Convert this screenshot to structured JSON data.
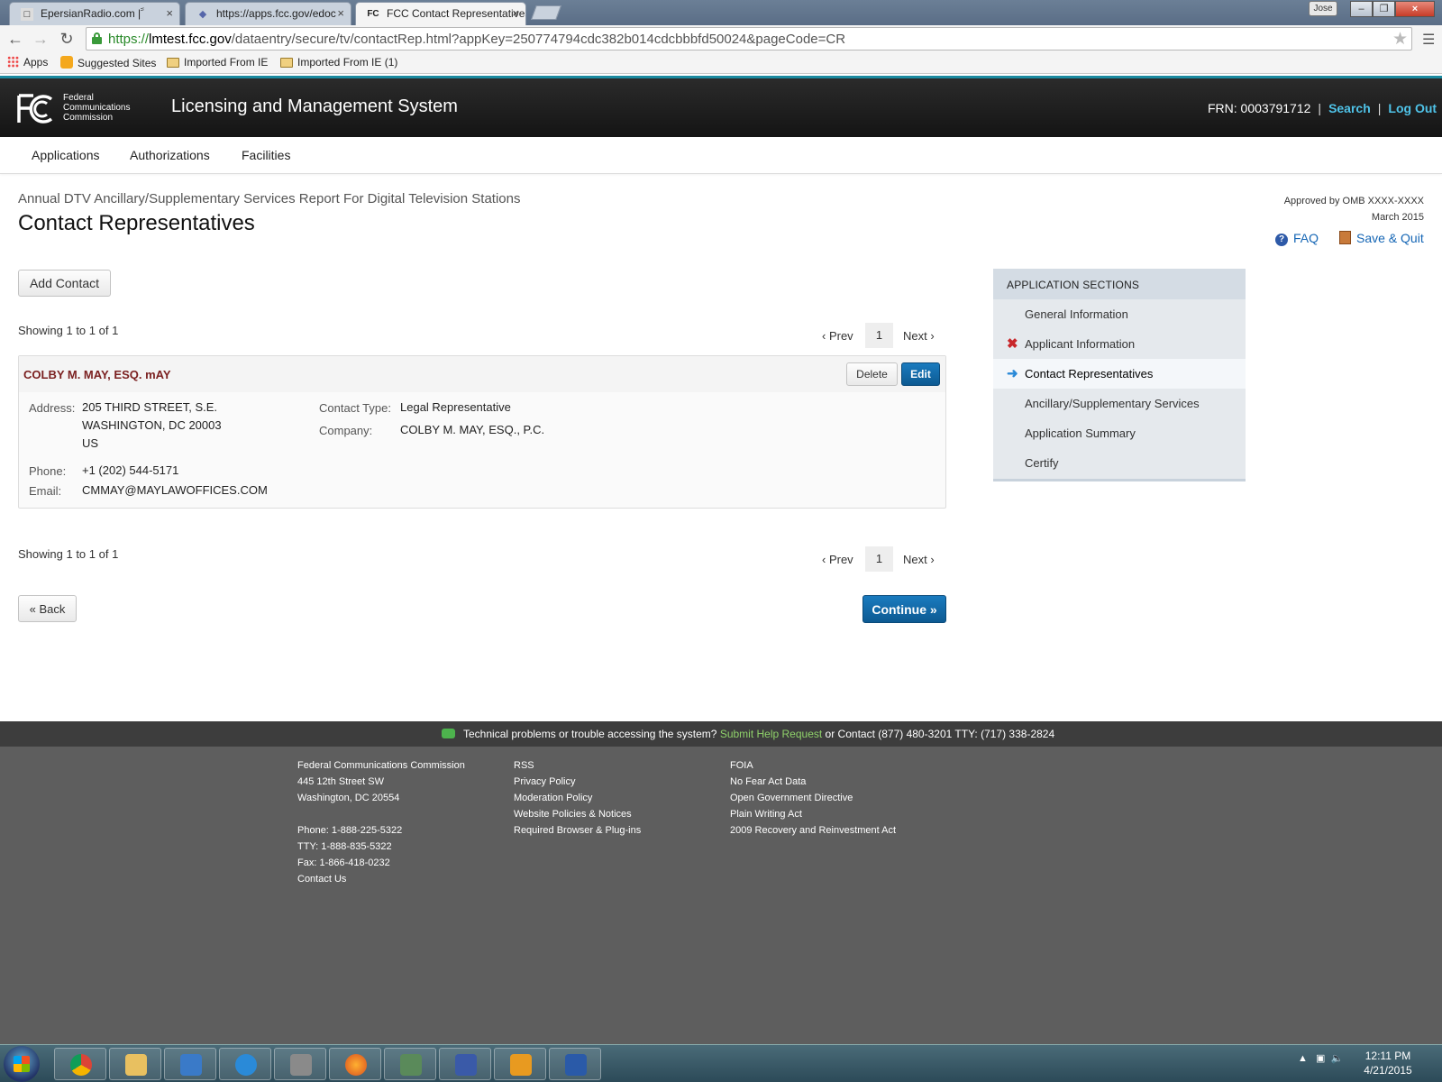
{
  "browser": {
    "tabs": [
      {
        "title": "EpersianRadio.com | ََ",
        "favicon": "radio-favicon"
      },
      {
        "title": "https://apps.fcc.gov/edoc",
        "favicon": "fcc-edocs-favicon"
      },
      {
        "title": "FCC Contact Representatives",
        "favicon": "fcc-favicon"
      }
    ],
    "window_user": "Jose",
    "url": {
      "scheme": "https://",
      "host": "lmtest.fcc.gov",
      "path": "/dataentry/secure/tv/contactRep.html?appKey=250774794cdc382b014cdcbbbfd50024&pageCode=CR"
    },
    "bookmarks": [
      "Apps",
      "Suggested Sites",
      "Imported From IE",
      "Imported From IE (1)"
    ]
  },
  "header": {
    "logo_text": [
      "Federal",
      "Communications",
      "Commission"
    ],
    "system_title": "Licensing and Management System",
    "frn": "FRN: 0003791712",
    "search_label": "Search",
    "logout_label": "Log Out"
  },
  "nav": {
    "items": [
      "Applications",
      "Authorizations",
      "Facilities"
    ]
  },
  "page": {
    "report_title": "Annual DTV Ancillary/Supplementary Services Report For Digital Television Stations",
    "title": "Contact Representatives",
    "omb_line1": "Approved by OMB XXXX-XXXX",
    "omb_line2": "March 2015",
    "faq_label": "FAQ",
    "save_quit_label": "Save & Quit",
    "add_contact_label": "Add Contact",
    "showing_text": "Showing 1 to 1 of 1",
    "pager": {
      "prev": "‹ Prev",
      "page": "1",
      "next": "Next ›"
    },
    "back_label": "« Back",
    "continue_label": "Continue »"
  },
  "contact": {
    "name": "COLBY M. MAY, ESQ. mAY",
    "delete_label": "Delete",
    "edit_label": "Edit",
    "labels": {
      "address": "Address:",
      "phone": "Phone:",
      "email": "Email:",
      "contact_type": "Contact Type:",
      "company": "Company:"
    },
    "address_lines": [
      "205 THIRD STREET, S.E.",
      "WASHINGTON, DC 20003",
      "US"
    ],
    "phone": "+1 (202) 544-5171",
    "email": "CMMAY@MAYLAWOFFICES.COM",
    "contact_type": "Legal Representative",
    "company": "COLBY M. MAY, ESQ., P.C."
  },
  "sidebar": {
    "title": "Application Sections",
    "items": [
      {
        "label": "General Information",
        "status": "none"
      },
      {
        "label": "Applicant Information",
        "status": "error"
      },
      {
        "label": "Contact Representatives",
        "status": "current"
      },
      {
        "label": "Ancillary/Supplementary Services",
        "status": "none"
      },
      {
        "label": "Application Summary",
        "status": "none"
      },
      {
        "label": "Certify",
        "status": "none"
      }
    ]
  },
  "footer": {
    "help_text": "Technical problems or trouble accessing the system?",
    "help_link": "Submit Help Request",
    "help_contact": "or Contact (877) 480-3201 TTY: (717) 338-2824",
    "col1": [
      "Federal Communications Commission",
      "445 12th Street SW",
      "Washington, DC 20554"
    ],
    "col1b": [
      "Phone: 1-888-225-5322",
      "TTY: 1-888-835-5322",
      "Fax: 1-866-418-0232",
      "Contact Us"
    ],
    "col2": [
      "RSS",
      "Privacy Policy",
      "Moderation Policy",
      "Website Policies & Notices",
      "Required Browser & Plug-ins"
    ],
    "col3": [
      "FOIA",
      "No Fear Act Data",
      "Open Government Directive",
      "Plain Writing Act",
      "2009 Recovery and Reinvestment Act"
    ]
  },
  "taskbar": {
    "apps": [
      "chrome-icon",
      "file-explorer-icon",
      "media-player-icon",
      "internet-explorer-icon",
      "calculator-icon",
      "firefox-icon",
      "remote-desktop-icon",
      "network-icon",
      "outlook-icon",
      "word-icon"
    ],
    "time": "12:11 PM",
    "date": "4/21/2015"
  },
  "colors": {
    "header_bg": "#1c1c1c",
    "link_blue": "#1566b5",
    "primary_button": "#0d5a92",
    "contact_name": "#7a1f1f",
    "error_mark": "#c8262a",
    "footer_bg": "#5e5e5e"
  }
}
